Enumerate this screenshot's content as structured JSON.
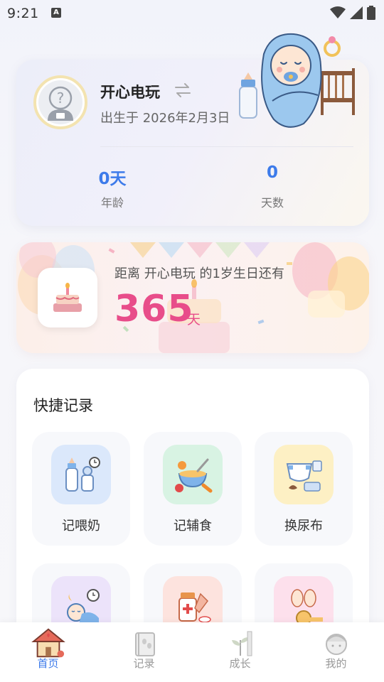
{
  "status_bar": {
    "time": "9:21",
    "notification_icon": "A"
  },
  "profile": {
    "name": "开心电玩",
    "birth": "出生于 2026年2月3日",
    "stats": [
      {
        "value": "0天",
        "label": "年龄"
      },
      {
        "value": "0",
        "label": "天数"
      }
    ]
  },
  "birthday": {
    "text": "距离 开心电玩 的1岁生日还有",
    "days": "365",
    "unit": "天"
  },
  "quick_record": {
    "title": "快捷记录",
    "items": [
      {
        "label": "记喂奶",
        "icon": "feeding-icon",
        "color": "#dbe8fb"
      },
      {
        "label": "记辅食",
        "icon": "solid-food-icon",
        "color": "#d8f3e3"
      },
      {
        "label": "换尿布",
        "icon": "diaper-icon",
        "color": "#fdf0c4"
      },
      {
        "label": "",
        "icon": "sleep-icon",
        "color": "#ece3fa"
      },
      {
        "label": "",
        "icon": "medicine-icon",
        "color": "#fde3de"
      },
      {
        "label": "",
        "icon": "growth-measure-icon",
        "color": "#fde0ec"
      }
    ]
  },
  "nav": [
    {
      "label": "首页",
      "icon": "home-icon",
      "active": true
    },
    {
      "label": "记录",
      "icon": "record-book-icon",
      "active": false
    },
    {
      "label": "成长",
      "icon": "growth-icon",
      "active": false
    },
    {
      "label": "我的",
      "icon": "profile-icon",
      "active": false
    }
  ],
  "colors": {
    "accent": "#3d7bea",
    "pink": "#e84d8a"
  }
}
